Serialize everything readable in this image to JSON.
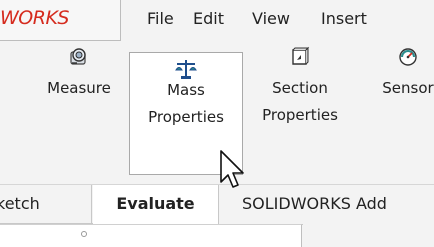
{
  "app": {
    "logo_text": "WORKS"
  },
  "menu": {
    "file": "File",
    "edit": "Edit",
    "view": "View",
    "insert": "Insert"
  },
  "tools": [
    {
      "line1": "Measure",
      "line2": "",
      "icon": "measure-icon"
    },
    {
      "line1": "Mass",
      "line2": "Properties",
      "icon": "scale-icon"
    },
    {
      "line1": "Section",
      "line2": "Properties",
      "icon": "section-properties-icon"
    },
    {
      "line1": "Sensor",
      "line2": "",
      "icon": "sensor-gauge-icon"
    }
  ],
  "tabs": {
    "sketch": "ketch",
    "evaluate": "Evaluate",
    "addins": "SOLIDWORKS Add"
  },
  "colors": {
    "brand": "#d52b1e",
    "icon_blue": "#1f4e8c",
    "icon_teal": "#2a8c8c"
  }
}
